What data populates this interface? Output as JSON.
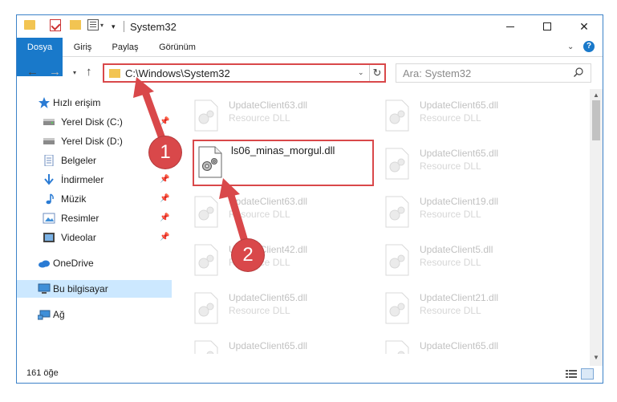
{
  "window": {
    "title": "System32"
  },
  "ribbon": {
    "tabs": [
      "Dosya",
      "Giriş",
      "Paylaş",
      "Görünüm"
    ]
  },
  "navigation": {
    "address": "C:\\Windows\\System32",
    "search_placeholder": "Ara: System32"
  },
  "sidebar": {
    "items": [
      {
        "label": "Hızlı erişim",
        "icon": "star-icon"
      },
      {
        "label": "Yerel Disk (C:)",
        "icon": "drive-icon"
      },
      {
        "label": "Yerel Disk (D:)",
        "icon": "drive-icon"
      },
      {
        "label": "Belgeler",
        "icon": "documents-icon"
      },
      {
        "label": "İndirmeler",
        "icon": "download-icon"
      },
      {
        "label": "Müzik",
        "icon": "music-icon"
      },
      {
        "label": "Resimler",
        "icon": "pictures-icon"
      },
      {
        "label": "Videolar",
        "icon": "videos-icon"
      },
      {
        "label": "OneDrive",
        "icon": "cloud-icon"
      },
      {
        "label": "Bu bilgisayar",
        "icon": "computer-icon"
      },
      {
        "label": "Ağ",
        "icon": "network-icon"
      }
    ]
  },
  "files": {
    "left": [
      {
        "name": "UpdateClient63.dll",
        "type": "Resource DLL"
      },
      {
        "name": "UpdateClient63.dll",
        "type": "Resource DLL"
      },
      {
        "name": "UpdateClient42.dll",
        "type": "Resource DLL"
      },
      {
        "name": "UpdateClient65.dll",
        "type": "Resource DLL"
      },
      {
        "name": "UpdateClient65.dll",
        "type": "Resource DLL"
      }
    ],
    "right": [
      {
        "name": "UpdateClient65.dll",
        "type": "Resource DLL"
      },
      {
        "name": "UpdateClient65.dll",
        "type": "Resource DLL"
      },
      {
        "name": "UpdateClient19.dll",
        "type": "Resource DLL"
      },
      {
        "name": "UpdateClient5.dll",
        "type": "Resource DLL"
      },
      {
        "name": "UpdateClient21.dll",
        "type": "Resource DLL"
      },
      {
        "name": "UpdateClient65.dll",
        "type": "Resource DLL"
      }
    ],
    "highlighted": {
      "name": "ls06_minas_morgul.dll"
    }
  },
  "status": {
    "item_count": "161 öğe"
  },
  "annotations": {
    "step1": "1",
    "step2": "2",
    "color": "#d9484a"
  },
  "colors": {
    "accent": "#1979ca",
    "selection": "#cce8ff",
    "folder": "#f2c452"
  }
}
